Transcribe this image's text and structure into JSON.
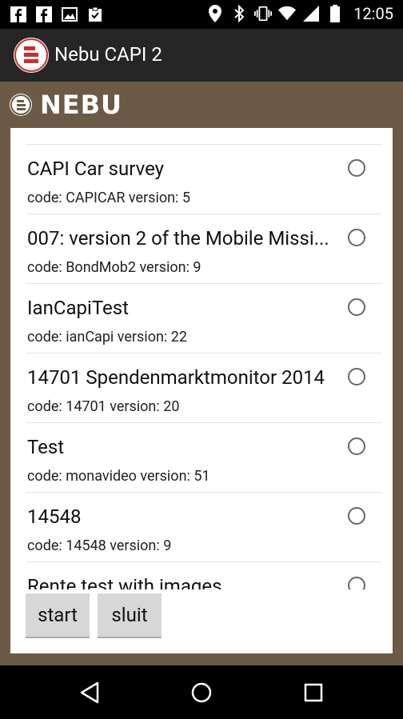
{
  "status_bar": {
    "time": "12:05",
    "left_icons": [
      "facebook-icon",
      "facebook-icon",
      "image-icon",
      "clipboard-check-icon"
    ],
    "right_icons": [
      "location-icon",
      "bluetooth-icon",
      "vibrate-icon",
      "wifi-icon",
      "signal-icon",
      "battery-icon"
    ]
  },
  "app_bar": {
    "title": "Nebu CAPI 2"
  },
  "brand": {
    "wordmark": "NEBU"
  },
  "surveys": [
    {
      "name": "CAPI Car survey",
      "meta": "code: CAPICAR version: 5",
      "selected": false
    },
    {
      "name": "007: version 2 of the Mobile Missi...",
      "meta": "code: BondMob2 version: 9",
      "selected": false
    },
    {
      "name": "IanCapiTest",
      "meta": "code: ianCapi version: 22",
      "selected": false
    },
    {
      "name": "14701 Spendenmarktmonitor 2014",
      "meta": "code: 14701 version: 20",
      "selected": false
    },
    {
      "name": "Test",
      "meta": "code: monavideo version: 51",
      "selected": false
    },
    {
      "name": "14548",
      "meta": "code: 14548 version: 9",
      "selected": false
    },
    {
      "name": "Rente test with images",
      "meta": "",
      "selected": false
    }
  ],
  "buttons": {
    "start": "start",
    "close": "sluit"
  },
  "colors": {
    "background": "#6b5a45",
    "app_bar": "#262626",
    "accent": "#c9302c"
  }
}
